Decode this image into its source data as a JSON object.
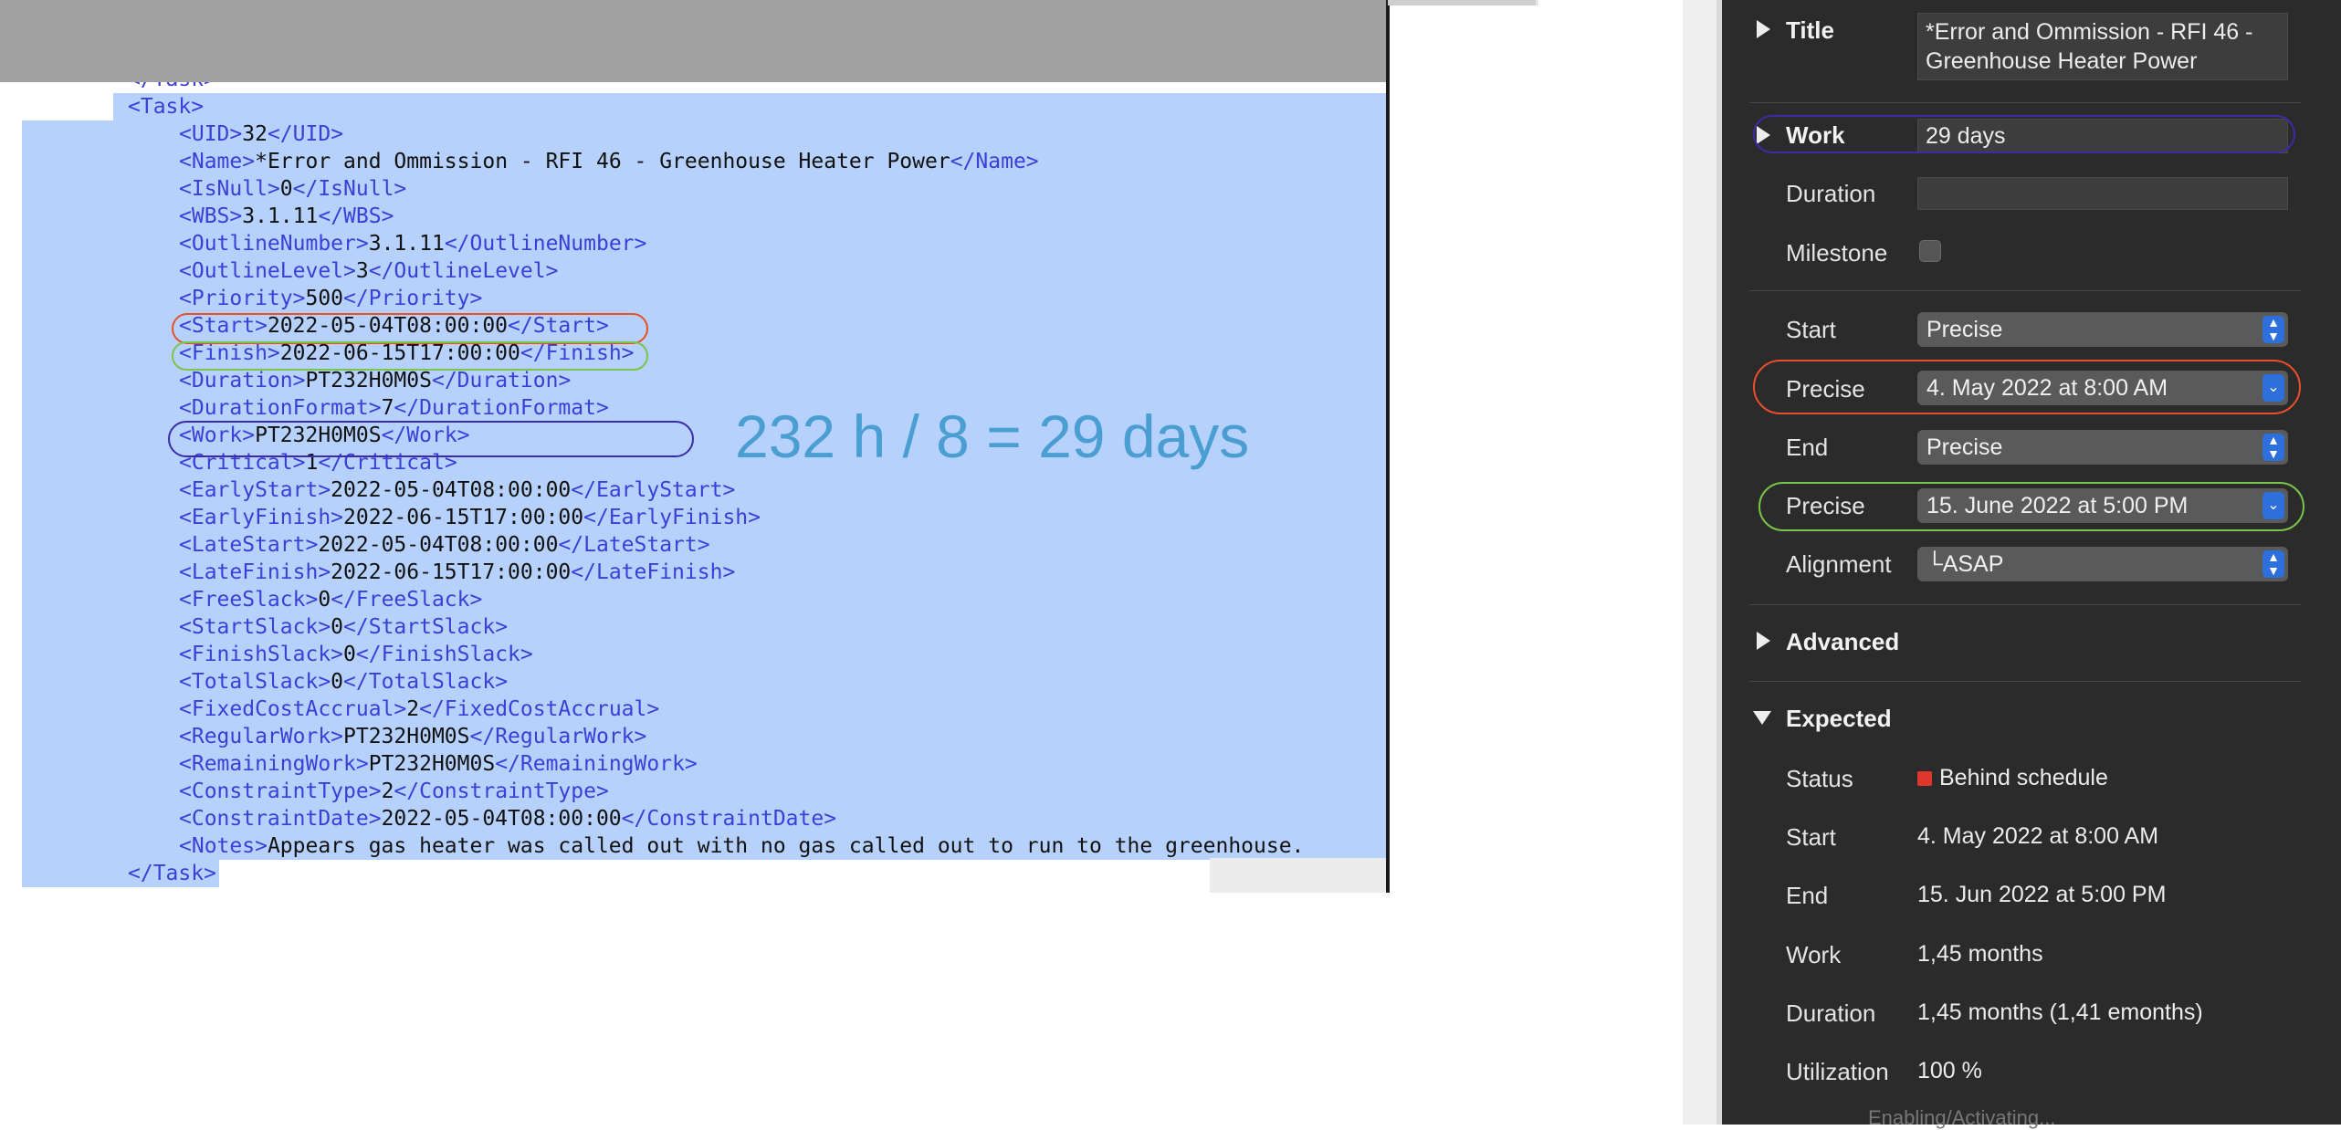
{
  "xml_lines": [
    {
      "o": "</Task>",
      "v": "",
      "c": ""
    },
    {
      "o": "<Task>",
      "v": "",
      "c": ""
    },
    {
      "o": "<UID>",
      "v": "32",
      "c": "</UID>"
    },
    {
      "o": "<Name>",
      "v": "*Error and Ommission - RFI 46 - Greenhouse Heater Power",
      "c": "</Name>"
    },
    {
      "o": "<IsNull>",
      "v": "0",
      "c": "</IsNull>"
    },
    {
      "o": "<WBS>",
      "v": "3.1.11",
      "c": "</WBS>"
    },
    {
      "o": "<OutlineNumber>",
      "v": "3.1.11",
      "c": "</OutlineNumber>"
    },
    {
      "o": "<OutlineLevel>",
      "v": "3",
      "c": "</OutlineLevel>"
    },
    {
      "o": "<Priority>",
      "v": "500",
      "c": "</Priority>"
    },
    {
      "o": "<Start>",
      "v": "2022-05-04T08:00:00",
      "c": "</Start>"
    },
    {
      "o": "<Finish>",
      "v": "2022-06-15T17:00:00",
      "c": "</Finish>"
    },
    {
      "o": "<Duration>",
      "v": "PT232H0M0S",
      "c": "</Duration>"
    },
    {
      "o": "<DurationFormat>",
      "v": "7",
      "c": "</DurationFormat>"
    },
    {
      "o": "<Work>",
      "v": "PT232H0M0S",
      "c": "</Work>"
    },
    {
      "o": "<Critical>",
      "v": "1",
      "c": "</Critical>"
    },
    {
      "o": "<EarlyStart>",
      "v": "2022-05-04T08:00:00",
      "c": "</EarlyStart>"
    },
    {
      "o": "<EarlyFinish>",
      "v": "2022-06-15T17:00:00",
      "c": "</EarlyFinish>"
    },
    {
      "o": "<LateStart>",
      "v": "2022-05-04T08:00:00",
      "c": "</LateStart>"
    },
    {
      "o": "<LateFinish>",
      "v": "2022-06-15T17:00:00",
      "c": "</LateFinish>"
    },
    {
      "o": "<FreeSlack>",
      "v": "0",
      "c": "</FreeSlack>"
    },
    {
      "o": "<StartSlack>",
      "v": "0",
      "c": "</StartSlack>"
    },
    {
      "o": "<FinishSlack>",
      "v": "0",
      "c": "</FinishSlack>"
    },
    {
      "o": "<TotalSlack>",
      "v": "0",
      "c": "</TotalSlack>"
    },
    {
      "o": "<FixedCostAccrual>",
      "v": "2",
      "c": "</FixedCostAccrual>"
    },
    {
      "o": "<RegularWork>",
      "v": "PT232H0M0S",
      "c": "</RegularWork>"
    },
    {
      "o": "<RemainingWork>",
      "v": "PT232H0M0S",
      "c": "</RemainingWork>"
    },
    {
      "o": "<ConstraintType>",
      "v": "2",
      "c": "</ConstraintType>"
    },
    {
      "o": "<ConstraintDate>",
      "v": "2022-05-04T08:00:00",
      "c": "</ConstraintDate>"
    },
    {
      "o": "<Notes>",
      "v": "Appears gas heater was called out with no gas called out to run to the greenhouse.",
      "c": ""
    },
    {
      "o": "</Task>",
      "v": "",
      "c": ""
    }
  ],
  "annotation": "232 h / 8 = 29 days",
  "inspector": {
    "title_label": "Title",
    "title_value": "*Error and Ommission - RFI 46 - Greenhouse Heater Power",
    "work_label": "Work",
    "work_value": "29 days",
    "duration_label": "Duration",
    "duration_value": "",
    "milestone_label": "Milestone",
    "milestone_checked": false,
    "start_label": "Start",
    "start_mode": "Precise",
    "start_precise_label": "Precise",
    "start_precise_value": "4. May 2022 at 8:00 AM",
    "end_label": "End",
    "end_mode": "Precise",
    "end_precise_label": "Precise",
    "end_precise_value": "15. June 2022 at 5:00 PM",
    "alignment_label": "Alignment",
    "alignment_value": "└ASAP",
    "advanced_label": "Advanced",
    "expected_label": "Expected",
    "expected": {
      "status_label": "Status",
      "status_value": "Behind schedule",
      "start_label": "Start",
      "start_value": "4. May 2022 at 8:00 AM",
      "end_label": "End",
      "end_value": "15. Jun 2022 at 5:00 PM",
      "work_label": "Work",
      "work_value": "1,45 months",
      "duration_label": "Duration",
      "duration_value": "1,45 months (1,41 emonths)",
      "utilization_label": "Utilization",
      "utilization_value": "100 %"
    },
    "bottom_partial_text": "Enabling/Activating..."
  },
  "colors": {
    "selection": "#b6d1fb",
    "xml_tag": "#3a3fd8",
    "marker_start": "#e8502a",
    "marker_finish": "#79c64a",
    "marker_work": "#3c2ba8",
    "annotation": "#4a9ed2",
    "status_red": "#e0372c",
    "accent_blue": "#2d6fdb"
  }
}
